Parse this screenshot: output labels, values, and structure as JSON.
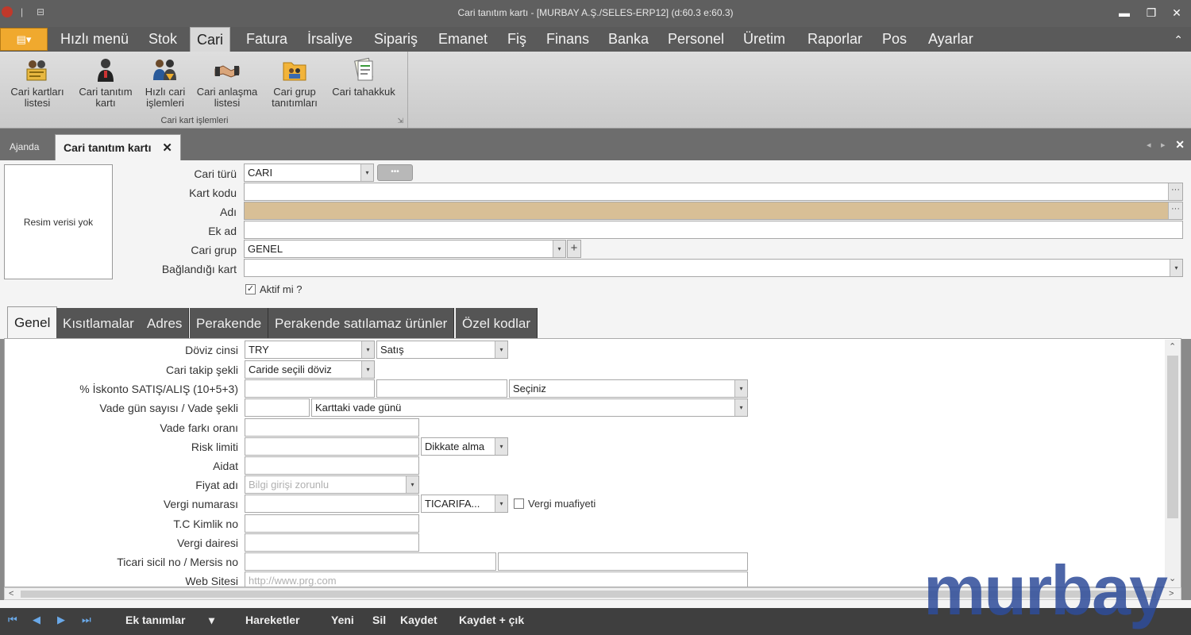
{
  "window": {
    "title": "Cari tanıtım kartı - [MURBAY A.Ş./SELES-ERP12] (d:60.3 e:60.3)",
    "quick_access": [
      "|",
      "⊟"
    ],
    "minimize": "▬",
    "restore": "❐",
    "close": "✕"
  },
  "menu": {
    "app_button": "▤▾",
    "items": [
      "Hızlı menü",
      "Stok",
      "Cari",
      "Fatura",
      "İrsaliye",
      "Sipariş",
      "Emanet",
      "Fiş",
      "Finans",
      "Banka",
      "Personel",
      "Üretim",
      "Raporlar",
      "Pos",
      "Ayarlar"
    ],
    "active": "Cari",
    "collapse": "⌃"
  },
  "ribbon": {
    "group_label": "Cari kart işlemleri",
    "corner": "⇲",
    "buttons": [
      {
        "line1": "Cari kartları",
        "line2": "listesi",
        "icon": "cards-list-icon"
      },
      {
        "line1": "Cari tanıtım",
        "line2": "kartı",
        "icon": "person-card-icon"
      },
      {
        "line1": "Hızlı cari",
        "line2": "işlemleri",
        "icon": "people-quick-icon"
      },
      {
        "line1": "Cari anlaşma",
        "line2": "listesi",
        "icon": "handshake-icon"
      },
      {
        "line1": "Cari grup",
        "line2": "tanıtımları",
        "icon": "group-folder-icon"
      },
      {
        "line1": "Cari tahakkuk",
        "line2": "",
        "icon": "accrual-docs-icon"
      }
    ]
  },
  "doc_tabs": {
    "tab1": "Ajanda",
    "tab2": "Cari tanıtım kartı",
    "close": "✕",
    "prev": "◂",
    "next": "▸",
    "close_all": "✕"
  },
  "form": {
    "photo_text": "Resim verisi yok",
    "cari_turu_label": "Cari türü",
    "cari_turu_value": "CARI",
    "cari_turu_btn": "•••",
    "kart_kodu_label": "Kart kodu",
    "kart_kodu_value": "",
    "adi_label": "Adı",
    "adi_value": "",
    "ek_ad_label": "Ek ad",
    "ek_ad_value": "",
    "cari_grup_label": "Cari grup",
    "cari_grup_value": "GENEL",
    "baglandigi_label": "Bağlandığı kart",
    "baglandigi_value": "",
    "aktif_label": "Aktif mi ?",
    "aktif_checked": true,
    "ellipsis": "···",
    "dd": "▾",
    "plus": "+"
  },
  "sub_tabs": [
    "Genel",
    "Kısıtlamalar",
    "Adres",
    "Perakende",
    "Perakende satılamaz ürünler",
    "Özel kodlar"
  ],
  "genel": {
    "doviz_label": "Döviz cinsi",
    "doviz_value": "TRY",
    "doviz_type": "Satış",
    "takip_label": "Cari takip şekli",
    "takip_value": "Caride seçili döviz",
    "iskonto_label": "% İskonto SATIŞ/ALIŞ (10+5+3)",
    "iskonto_sel": "Seçiniz",
    "vade_label": "Vade gün sayısı / Vade şekli",
    "vade_sel": "Karttaki vade günü",
    "vade_farki_label": "Vade farkı oranı",
    "risk_label": "Risk limiti",
    "risk_sel": "Dikkate alma",
    "aidat_label": "Aidat",
    "fiyat_label": "Fiyat adı",
    "fiyat_placeholder": "Bilgi girişi zorunlu",
    "vergi_no_label": "Vergi numarası",
    "vergi_sel": "TICARIFA...",
    "vergi_muaf_label": "Vergi muafiyeti",
    "tc_label": "T.C Kimlik no",
    "vergi_dairesi_label": "Vergi dairesi",
    "ticari_label": "Ticari sicil no / Mersis no",
    "web_label": "Web Sitesi",
    "web_placeholder": "http://www.prg.com"
  },
  "scroll": {
    "up": "⌃",
    "down": "⌄",
    "left": "<",
    "right": ">"
  },
  "footer": {
    "first": "⏮",
    "prev": "◀",
    "next": "▶",
    "last": "⏭",
    "ek_tanimlar": "Ek tanımlar",
    "ek_dd": "▾",
    "hareketler": "Hareketler",
    "yeni": "Yeni",
    "sil": "Sil",
    "kaydet": "Kaydet",
    "kaydet_cik": "Kaydet + çık"
  },
  "watermark": "murbay"
}
